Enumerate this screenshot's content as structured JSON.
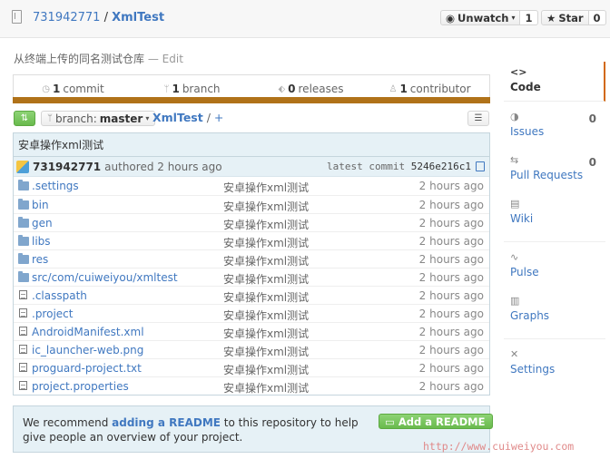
{
  "header": {
    "owner": "731942771",
    "separator": " / ",
    "repo": "XmlTest",
    "watch_label": "Unwatch",
    "watch_count": "1",
    "star_label": "Star",
    "star_count": "0"
  },
  "description": {
    "text": "从终端上传的同名测试仓库",
    "dash": " — ",
    "edit": "Edit"
  },
  "stats": {
    "commits_num": "1",
    "commits_label": "commit",
    "branches_num": "1",
    "branches_label": "branch",
    "releases_num": "0",
    "releases_label": "releases",
    "contributors_num": "1",
    "contributors_label": "contributor"
  },
  "nav": {
    "branch_prefix": "branch:",
    "branch_name": "master",
    "crumb_repo": "XmlTest",
    "crumb_sep": " / ",
    "crumb_plus": "+"
  },
  "commit": {
    "title": "安卓操作xml测试",
    "author": "731942771",
    "authored": "authored 2 hours ago",
    "latest_label": "latest commit",
    "sha": "5246e216c1"
  },
  "files": [
    {
      "type": "dir",
      "name": ".settings",
      "msg": "安卓操作xml测试",
      "age": "2 hours ago"
    },
    {
      "type": "dir",
      "name": "bin",
      "msg": "安卓操作xml测试",
      "age": "2 hours ago"
    },
    {
      "type": "dir",
      "name": "gen",
      "msg": "安卓操作xml测试",
      "age": "2 hours ago"
    },
    {
      "type": "dir",
      "name": "libs",
      "msg": "安卓操作xml测试",
      "age": "2 hours ago"
    },
    {
      "type": "dir",
      "name": "res",
      "msg": "安卓操作xml测试",
      "age": "2 hours ago"
    },
    {
      "type": "dir",
      "name": "src/com/cuiweiyou/xmltest",
      "msg": "安卓操作xml测试",
      "age": "2 hours ago"
    },
    {
      "type": "file",
      "name": ".classpath",
      "msg": "安卓操作xml测试",
      "age": "2 hours ago"
    },
    {
      "type": "file",
      "name": ".project",
      "msg": "安卓操作xml测试",
      "age": "2 hours ago"
    },
    {
      "type": "file",
      "name": "AndroidManifest.xml",
      "msg": "安卓操作xml测试",
      "age": "2 hours ago"
    },
    {
      "type": "file",
      "name": "ic_launcher-web.png",
      "msg": "安卓操作xml测试",
      "age": "2 hours ago"
    },
    {
      "type": "file",
      "name": "proguard-project.txt",
      "msg": "安卓操作xml测试",
      "age": "2 hours ago"
    },
    {
      "type": "file",
      "name": "project.properties",
      "msg": "安卓操作xml测试",
      "age": "2 hours ago"
    }
  ],
  "readme": {
    "pre": "We recommend ",
    "link": "adding a README",
    "post": " to this repository to help give people an overview of your project.",
    "button": "Add a README"
  },
  "sidebar": {
    "code": "Code",
    "issues": "Issues",
    "issues_count": "0",
    "pulls": "Pull Requests",
    "pulls_count": "0",
    "wiki": "Wiki",
    "pulse": "Pulse",
    "graphs": "Graphs",
    "settings": "Settings"
  },
  "watermark": "http://www.cuiweiyou.com"
}
